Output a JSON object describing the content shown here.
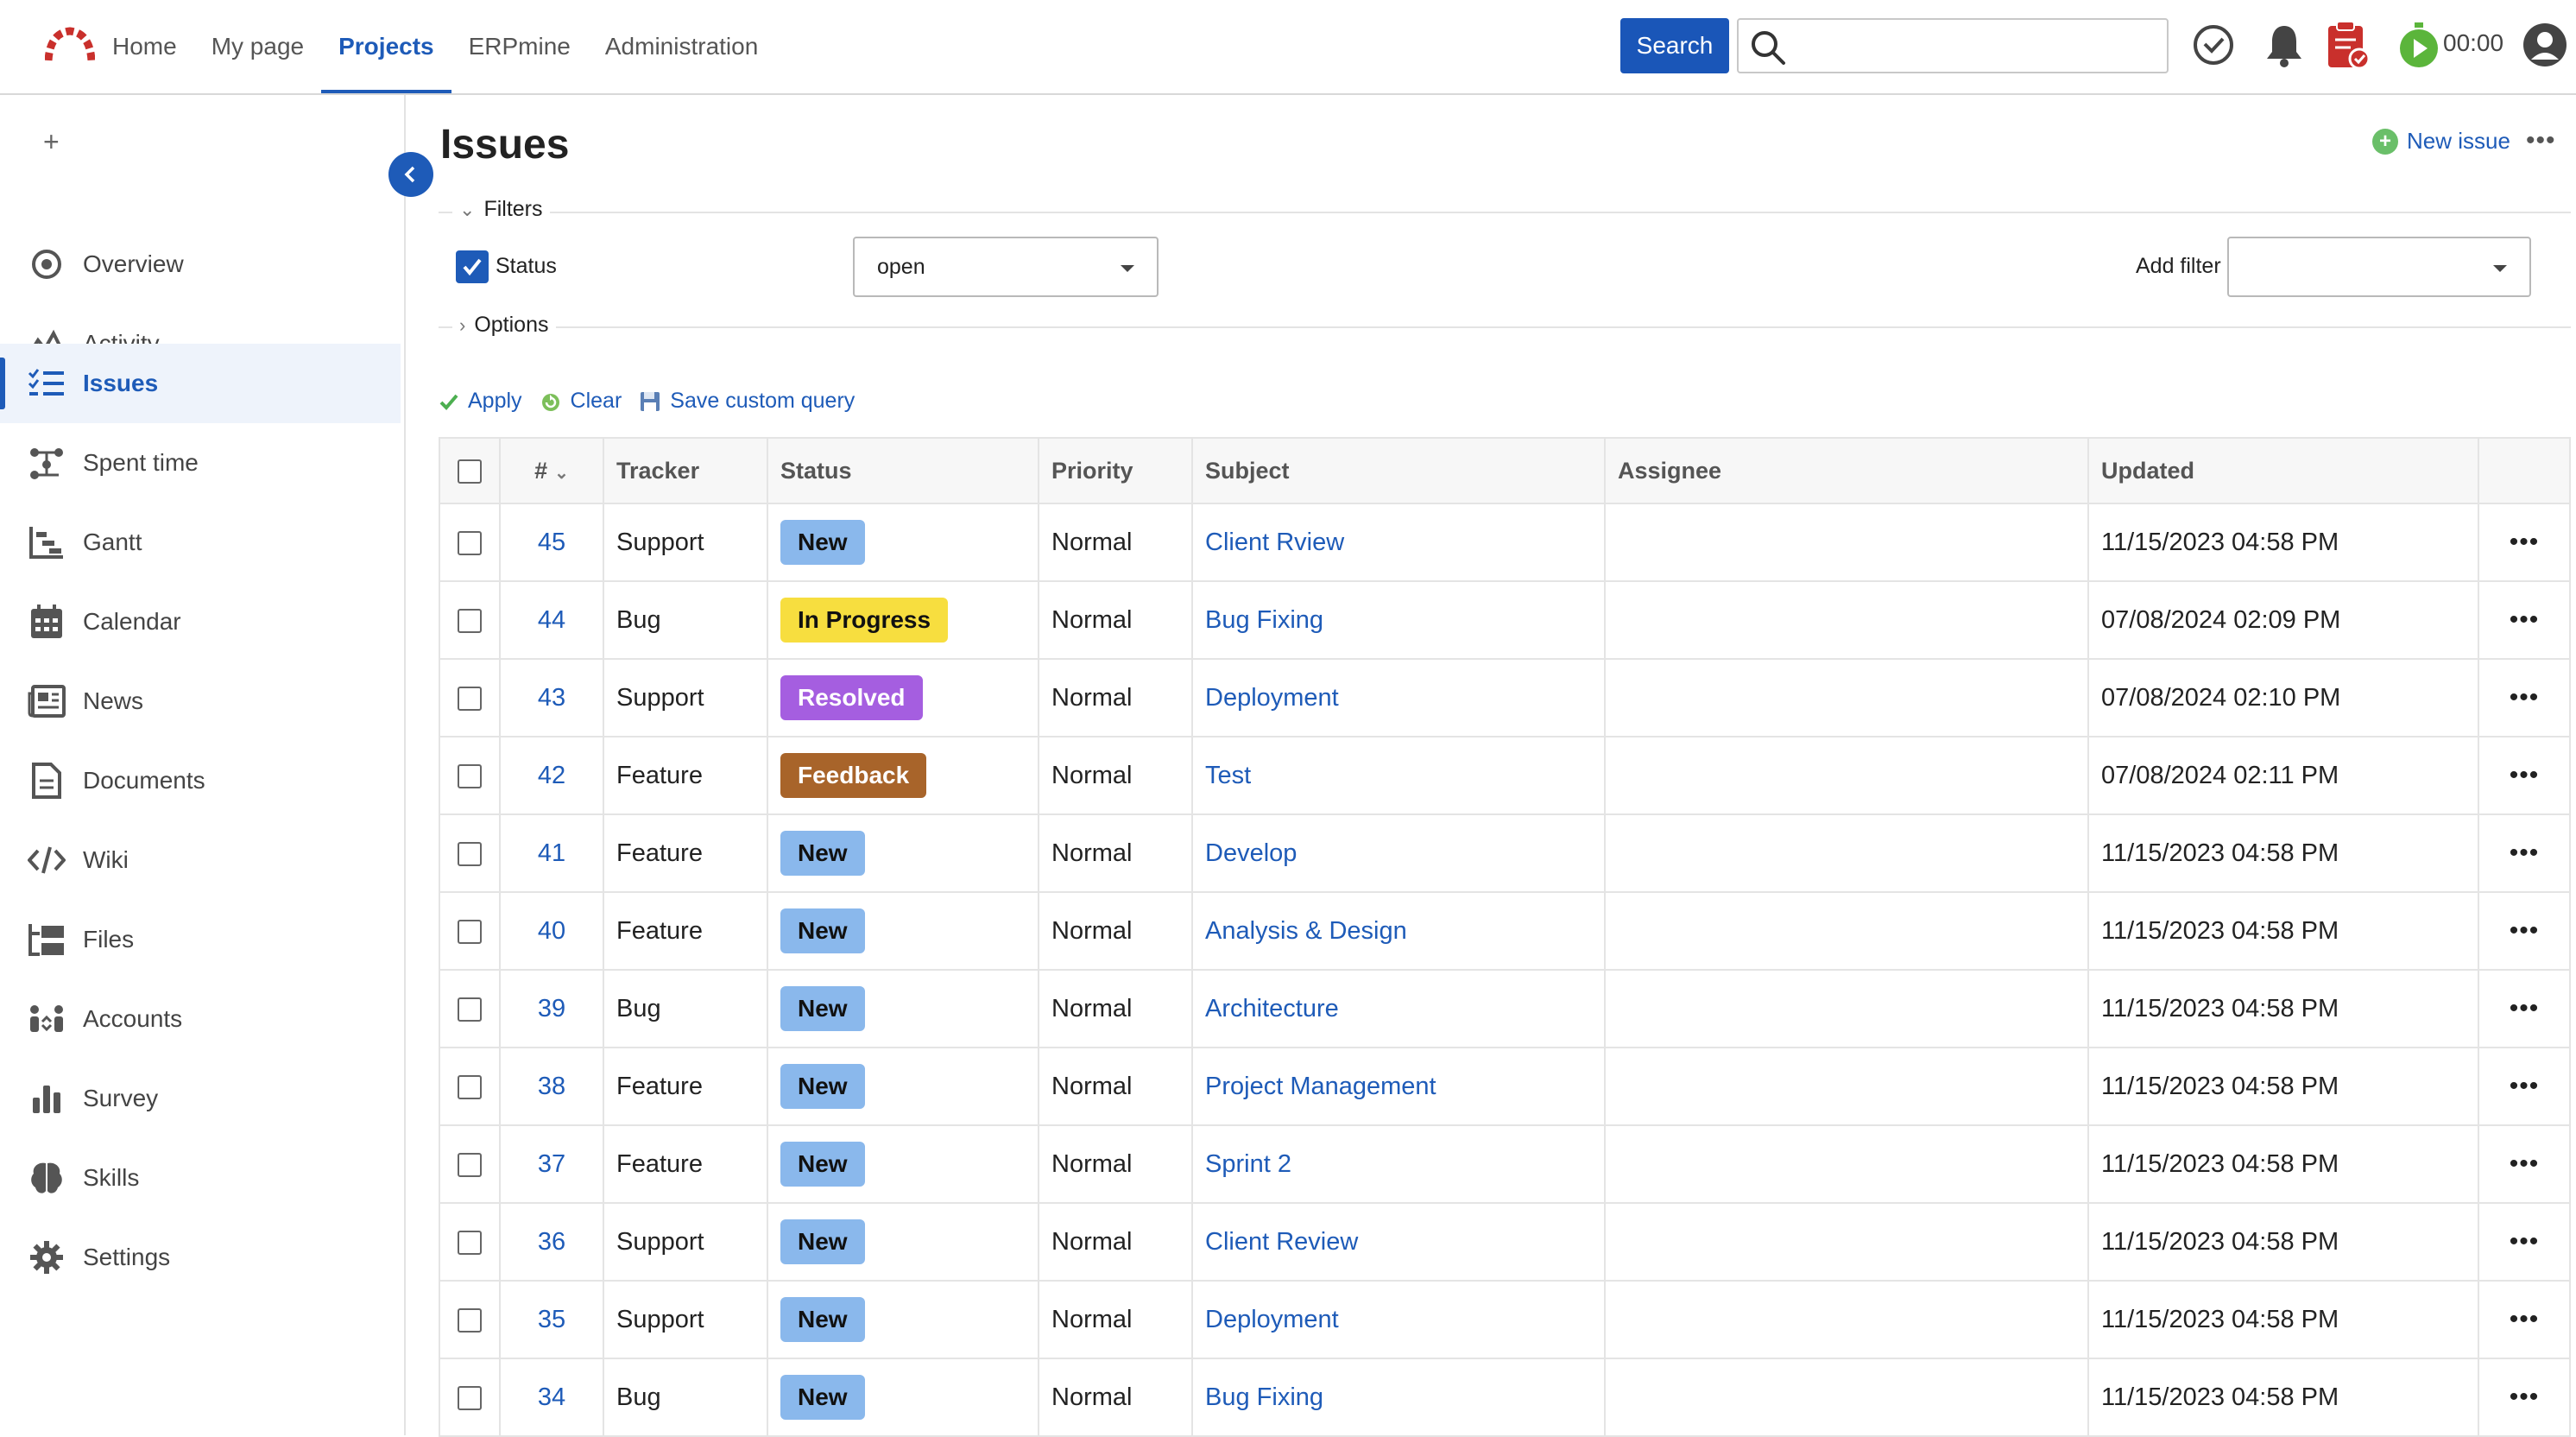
{
  "nav": {
    "items": [
      "Home",
      "My page",
      "Projects",
      "ERPmine",
      "Administration"
    ],
    "active_index": 2
  },
  "search": {
    "button_label": "Search",
    "placeholder": ""
  },
  "timer": {
    "value": "00:00"
  },
  "sidebar": {
    "plus": "+",
    "items": [
      {
        "label": "Overview",
        "icon": "overview-icon"
      },
      {
        "label": "Activity",
        "icon": "activity-icon"
      },
      {
        "label": "Issues",
        "icon": "issues-icon",
        "active": true
      },
      {
        "label": "Spent time",
        "icon": "spent-time-icon"
      },
      {
        "label": "Gantt",
        "icon": "gantt-icon"
      },
      {
        "label": "Calendar",
        "icon": "calendar-icon"
      },
      {
        "label": "News",
        "icon": "news-icon"
      },
      {
        "label": "Documents",
        "icon": "documents-icon"
      },
      {
        "label": "Wiki",
        "icon": "wiki-icon"
      },
      {
        "label": "Files",
        "icon": "files-icon"
      },
      {
        "label": "Accounts",
        "icon": "accounts-icon"
      },
      {
        "label": "Survey",
        "icon": "survey-icon"
      },
      {
        "label": "Skills",
        "icon": "skills-icon"
      },
      {
        "label": "Settings",
        "icon": "settings-icon"
      }
    ]
  },
  "page": {
    "title": "Issues",
    "new_issue": "New issue"
  },
  "filters": {
    "legend": "Filters",
    "status_label": "Status",
    "status_value": "open",
    "add_filter_label": "Add filter",
    "add_filter_value": "",
    "options_legend": "Options"
  },
  "actions": {
    "apply": "Apply",
    "clear": "Clear",
    "save": "Save custom query"
  },
  "table": {
    "headers": {
      "id": "#",
      "tracker": "Tracker",
      "status": "Status",
      "priority": "Priority",
      "subject": "Subject",
      "assignee": "Assignee",
      "updated": "Updated"
    },
    "status_colors": {
      "New": "#8ab8ec",
      "In Progress": "#f7de3f",
      "Resolved": "#a55ee0",
      "Feedback": "#a8642a"
    },
    "rows": [
      {
        "id": "45",
        "tracker": "Support",
        "status": "New",
        "priority": "Normal",
        "subject": "Client Rview",
        "assignee": "",
        "updated": "11/15/2023 04:58 PM"
      },
      {
        "id": "44",
        "tracker": "Bug",
        "status": "In Progress",
        "priority": "Normal",
        "subject": "Bug Fixing",
        "assignee": "",
        "updated": "07/08/2024 02:09 PM"
      },
      {
        "id": "43",
        "tracker": "Support",
        "status": "Resolved",
        "priority": "Normal",
        "subject": "Deployment",
        "assignee": "",
        "updated": "07/08/2024 02:10 PM"
      },
      {
        "id": "42",
        "tracker": "Feature",
        "status": "Feedback",
        "priority": "Normal",
        "subject": "Test",
        "assignee": "",
        "updated": "07/08/2024 02:11 PM"
      },
      {
        "id": "41",
        "tracker": "Feature",
        "status": "New",
        "priority": "Normal",
        "subject": "Develop",
        "assignee": "",
        "updated": "11/15/2023 04:58 PM"
      },
      {
        "id": "40",
        "tracker": "Feature",
        "status": "New",
        "priority": "Normal",
        "subject": "Analysis & Design",
        "assignee": "",
        "updated": "11/15/2023 04:58 PM"
      },
      {
        "id": "39",
        "tracker": "Bug",
        "status": "New",
        "priority": "Normal",
        "subject": "Architecture",
        "assignee": "",
        "updated": "11/15/2023 04:58 PM"
      },
      {
        "id": "38",
        "tracker": "Feature",
        "status": "New",
        "priority": "Normal",
        "subject": "Project Management",
        "assignee": "",
        "updated": "11/15/2023 04:58 PM"
      },
      {
        "id": "37",
        "tracker": "Feature",
        "status": "New",
        "priority": "Normal",
        "subject": "Sprint 2",
        "assignee": "",
        "updated": "11/15/2023 04:58 PM"
      },
      {
        "id": "36",
        "tracker": "Support",
        "status": "New",
        "priority": "Normal",
        "subject": "Client Review",
        "assignee": "",
        "updated": "11/15/2023 04:58 PM"
      },
      {
        "id": "35",
        "tracker": "Support",
        "status": "New",
        "priority": "Normal",
        "subject": "Deployment",
        "assignee": "",
        "updated": "11/15/2023 04:58 PM"
      },
      {
        "id": "34",
        "tracker": "Bug",
        "status": "New",
        "priority": "Normal",
        "subject": "Bug Fixing",
        "assignee": "",
        "updated": "11/15/2023 04:58 PM"
      }
    ]
  }
}
